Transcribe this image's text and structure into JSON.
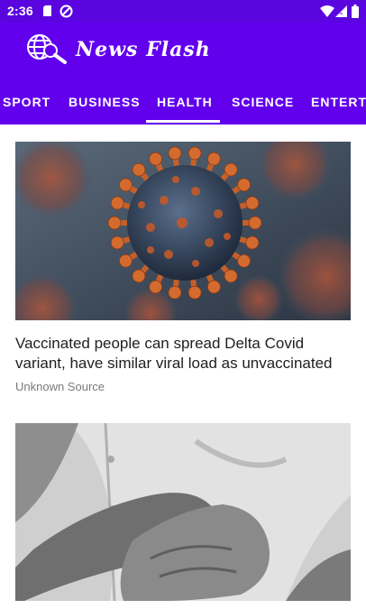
{
  "status_bar": {
    "time": "2:36",
    "icons": [
      "sd-card-icon",
      "sync-icon",
      "wifi-icon",
      "signal-icon",
      "battery-icon"
    ]
  },
  "app_bar": {
    "title": "News Flash",
    "logo_icon": "globe-search-icon"
  },
  "tabs": [
    {
      "label": "SPORT",
      "selected": false
    },
    {
      "label": "BUSINESS",
      "selected": false
    },
    {
      "label": "HEALTH",
      "selected": true
    },
    {
      "label": "SCIENCE",
      "selected": false
    },
    {
      "label": "ENTERTA",
      "selected": false
    }
  ],
  "articles": [
    {
      "image": "coronavirus-image",
      "title_line1": "Vaccinated people can spread Delta Covid",
      "title_line2": "variant, have similar viral load as unvaccinated",
      "source": "Unknown Source"
    },
    {
      "image": "chest-pain-image"
    }
  ],
  "colors": {
    "primary": "#6200ee",
    "status_bar": "#5a05e0",
    "on_primary": "#ffffff",
    "text_primary": "#1f1f1f",
    "text_secondary": "#7a7a7a"
  }
}
